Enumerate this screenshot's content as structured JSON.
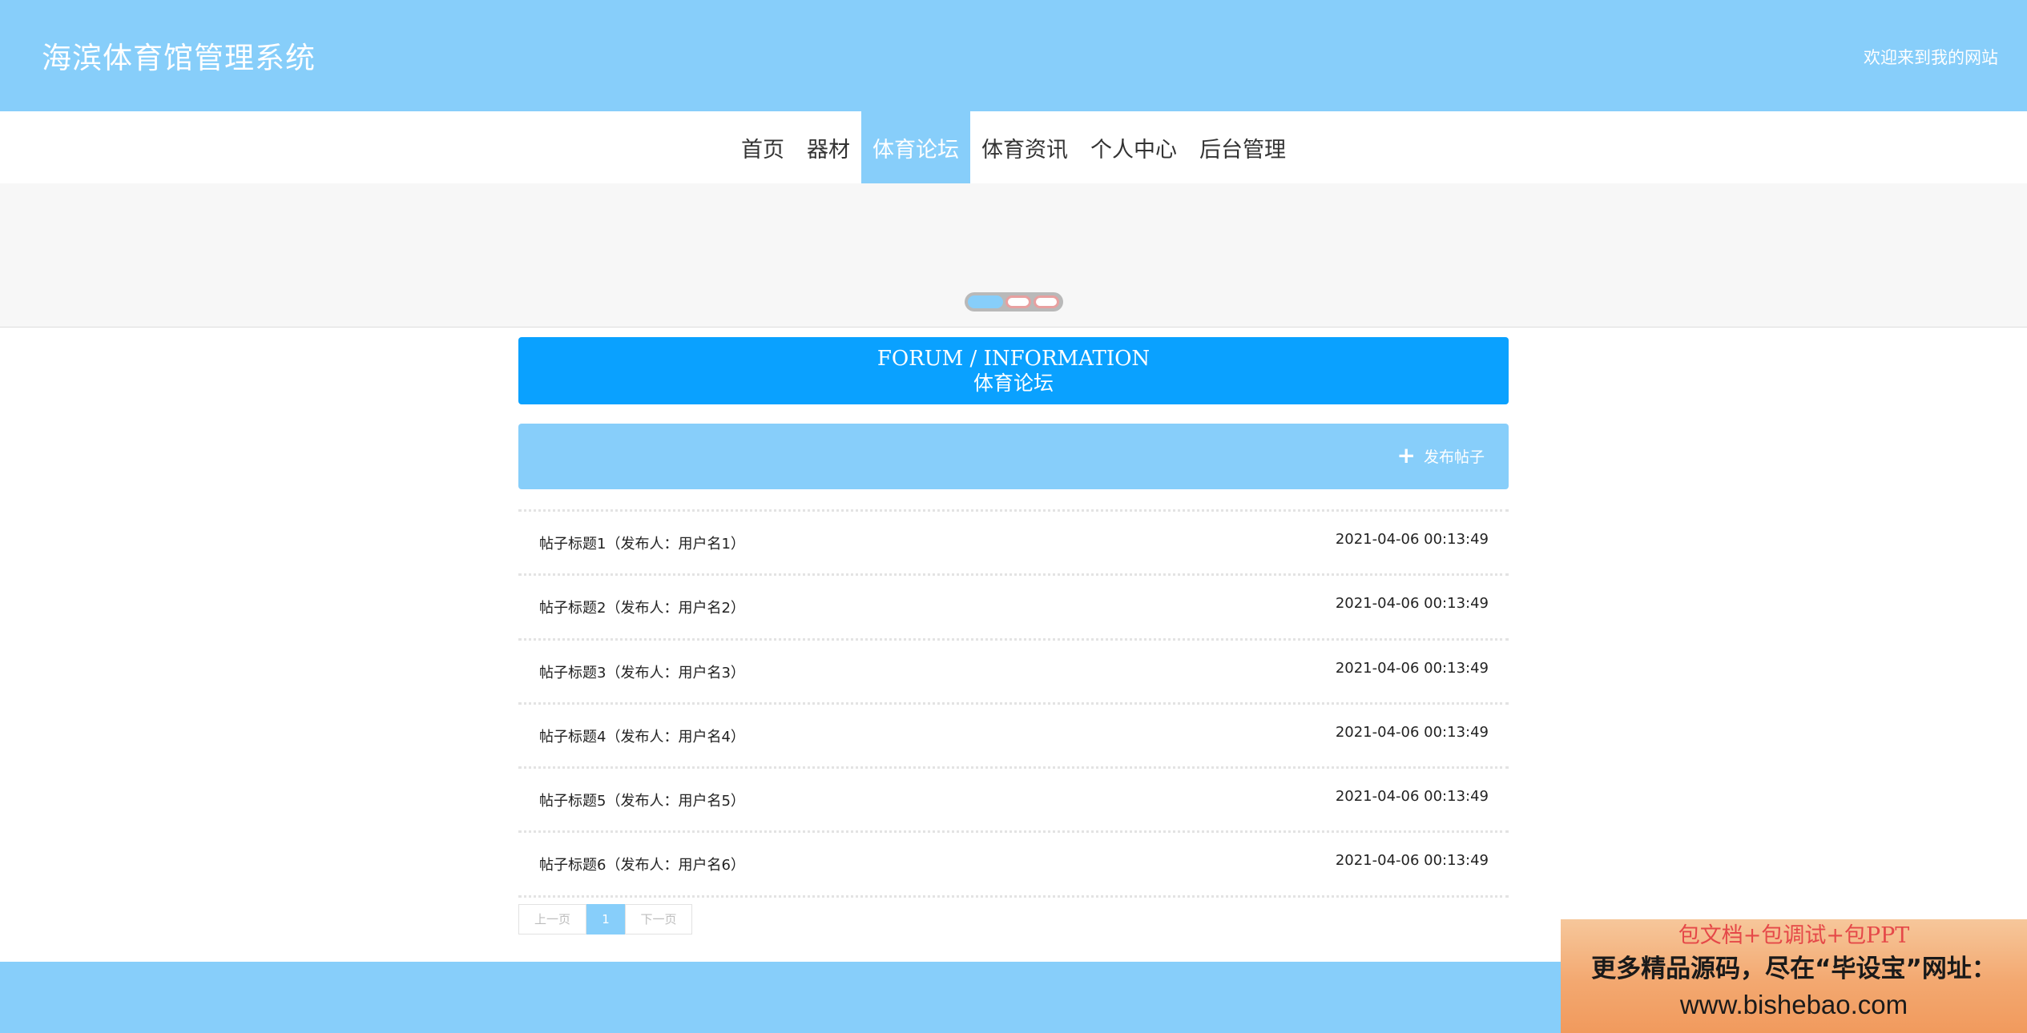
{
  "header": {
    "site_title": "海滨体育馆管理系统",
    "welcome": "欢迎来到我的网站"
  },
  "nav": {
    "items": [
      {
        "label": "首页",
        "active": false
      },
      {
        "label": "器材",
        "active": false
      },
      {
        "label": "体育论坛",
        "active": true
      },
      {
        "label": "体育资讯",
        "active": false
      },
      {
        "label": "个人中心",
        "active": false
      },
      {
        "label": "后台管理",
        "active": false
      }
    ]
  },
  "banner": {
    "slide_count": 3,
    "active_slide": 1
  },
  "forum": {
    "title_en": "FORUM / INFORMATION",
    "title_cn": "体育论坛",
    "publish_label": "发布帖子",
    "posts": [
      {
        "title": "帖子标题1（发布人：用户名1）",
        "time": "2021-04-06 00:13:49"
      },
      {
        "title": "帖子标题2（发布人：用户名2）",
        "time": "2021-04-06 00:13:49"
      },
      {
        "title": "帖子标题3（发布人：用户名3）",
        "time": "2021-04-06 00:13:49"
      },
      {
        "title": "帖子标题4（发布人：用户名4）",
        "time": "2021-04-06 00:13:49"
      },
      {
        "title": "帖子标题5（发布人：用户名5）",
        "time": "2021-04-06 00:13:49"
      },
      {
        "title": "帖子标题6（发布人：用户名6）",
        "time": "2021-04-06 00:13:49"
      }
    ]
  },
  "pagination": {
    "prev_label": "上一页",
    "current_page": "1",
    "next_label": "下一页"
  },
  "ad": {
    "line1": "包文档+包调试+包PPT",
    "line2": "更多精品源码，尽在“毕设宝”网址：",
    "line3": "www.bishebao.com"
  },
  "colors": {
    "header_bg": "#87cefa",
    "forum_head_bg": "#0aa1ff",
    "active_nav_bg": "#87cefa"
  }
}
